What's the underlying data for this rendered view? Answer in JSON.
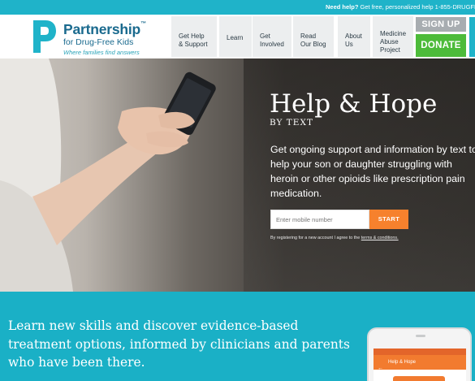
{
  "topbar": {
    "lead": "Need help?",
    "text": "Get free, personalized help 1-855-DRUGFREE"
  },
  "logo": {
    "name_line1": "Partnership",
    "tm": "™",
    "name_line2": "for Drug-Free Kids",
    "tagline": "Where families find answers"
  },
  "nav": {
    "items": [
      {
        "label": "Get Help\n& Support"
      },
      {
        "label": "Learn"
      },
      {
        "label": "Get\nInvolved"
      },
      {
        "label": "Read\nOur Blog"
      },
      {
        "label": "About\nUs"
      },
      {
        "label": "Medicine\nAbuse\nProject"
      }
    ],
    "signup": "SIGN UP",
    "donate": "DONATE"
  },
  "hero": {
    "title": "Help & Hope",
    "subtitle": "BY TEXT",
    "body": "Get ongoing support and information by text to help your son or daughter struggling with heroin or other opioids like prescription pain medication.",
    "input_placeholder": "Enter mobile number",
    "start": "START",
    "terms_prefix": "By registering for a new account I agree to the",
    "terms_link": "terms & conditions."
  },
  "bottom": {
    "text": "Learn new skills and discover evidence-based treatment options, informed by clinicians and parents who have been there.",
    "phone_app_title": "Help & Hope"
  },
  "colors": {
    "teal": "#1fb3c9",
    "orange": "#f6812d",
    "green": "#4dbb3a",
    "gray_button": "#a8adb1"
  }
}
